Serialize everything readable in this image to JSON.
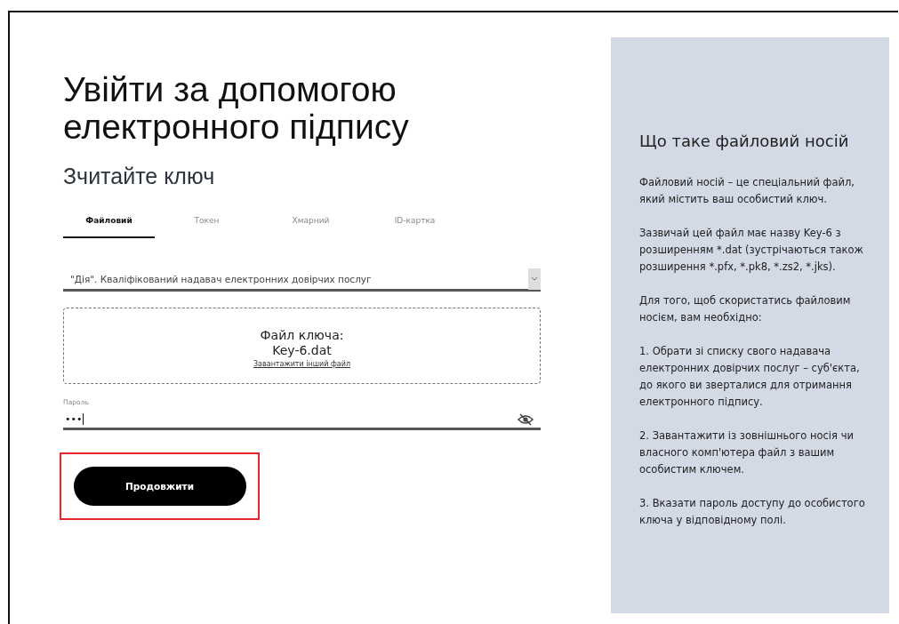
{
  "title": "Увійти за допомогою електронного підпису",
  "subtitle": "Зчитайте ключ",
  "tabs": [
    {
      "label": "Файловий",
      "selected": true
    },
    {
      "label": "Токен",
      "selected": false
    },
    {
      "label": "Хмарний",
      "selected": false
    },
    {
      "label": "ID-картка",
      "selected": false
    }
  ],
  "provider_select": {
    "value": "\"Дія\". Кваліфікований надавач електронних довірчих послуг"
  },
  "key_file": {
    "label": "Файл ключа:",
    "file_name": "Key-6.dat",
    "link": "Завантажити інший файл"
  },
  "password": {
    "label": "Пароль",
    "value": "•••",
    "visible": false
  },
  "continue_button": {
    "label": "Продовжити",
    "highlighted": true
  },
  "help_panel": {
    "title": "Що таке файловий носій",
    "paragraphs": [
      "Файловий носій – це спеціальний файл, який містить ваш особистий ключ.",
      "Зазвичай цей файл має назву Key-6 з розширенням *.dat (зустрічаються також розширення *.pfx, *.pk8, *.zs2, *.jks).",
      "Для того, щоб скористатись файловим носієм, вам необхідно:",
      "1. Обрати зі списку свого надавача електронних довірчих послуг – суб'єкта, до якого ви зверталися для отримання електронного підпису.",
      "2. Завантажити із зовнішнього носія чи власного комп'ютера файл з вашим особистим ключем.",
      "3. Вказати пароль доступу до особистого ключа у відповідному полі."
    ]
  }
}
